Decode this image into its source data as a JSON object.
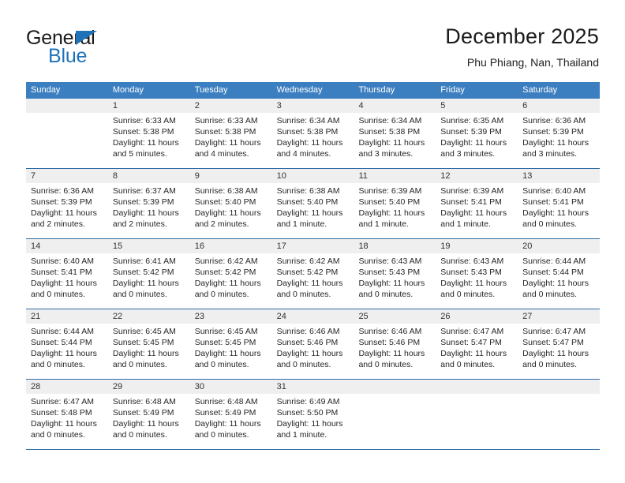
{
  "brand": {
    "name_dark": "General",
    "name_blue": "Blue",
    "triangle_icon": "triangle-logo-icon",
    "accent_color": "#1f72b8"
  },
  "header": {
    "month_title": "December 2025",
    "location": "Phu Phiang, Nan, Thailand"
  },
  "colors": {
    "header_blue": "#3c7fc0",
    "week_divider": "#2e6da4",
    "band_gray": "#efefef",
    "text": "#262626"
  },
  "weekdays": [
    "Sunday",
    "Monday",
    "Tuesday",
    "Wednesday",
    "Thursday",
    "Friday",
    "Saturday"
  ],
  "weeks": [
    {
      "days": [
        {
          "num": "",
          "sunrise": "",
          "sunset": "",
          "daylight_1": "",
          "daylight_2": "",
          "empty": true
        },
        {
          "num": "1",
          "sunrise": "Sunrise: 6:33 AM",
          "sunset": "Sunset: 5:38 PM",
          "daylight_1": "Daylight: 11 hours",
          "daylight_2": "and 5 minutes.",
          "empty": false
        },
        {
          "num": "2",
          "sunrise": "Sunrise: 6:33 AM",
          "sunset": "Sunset: 5:38 PM",
          "daylight_1": "Daylight: 11 hours",
          "daylight_2": "and 4 minutes.",
          "empty": false
        },
        {
          "num": "3",
          "sunrise": "Sunrise: 6:34 AM",
          "sunset": "Sunset: 5:38 PM",
          "daylight_1": "Daylight: 11 hours",
          "daylight_2": "and 4 minutes.",
          "empty": false
        },
        {
          "num": "4",
          "sunrise": "Sunrise: 6:34 AM",
          "sunset": "Sunset: 5:38 PM",
          "daylight_1": "Daylight: 11 hours",
          "daylight_2": "and 3 minutes.",
          "empty": false
        },
        {
          "num": "5",
          "sunrise": "Sunrise: 6:35 AM",
          "sunset": "Sunset: 5:39 PM",
          "daylight_1": "Daylight: 11 hours",
          "daylight_2": "and 3 minutes.",
          "empty": false
        },
        {
          "num": "6",
          "sunrise": "Sunrise: 6:36 AM",
          "sunset": "Sunset: 5:39 PM",
          "daylight_1": "Daylight: 11 hours",
          "daylight_2": "and 3 minutes.",
          "empty": false
        }
      ]
    },
    {
      "days": [
        {
          "num": "7",
          "sunrise": "Sunrise: 6:36 AM",
          "sunset": "Sunset: 5:39 PM",
          "daylight_1": "Daylight: 11 hours",
          "daylight_2": "and 2 minutes.",
          "empty": false
        },
        {
          "num": "8",
          "sunrise": "Sunrise: 6:37 AM",
          "sunset": "Sunset: 5:39 PM",
          "daylight_1": "Daylight: 11 hours",
          "daylight_2": "and 2 minutes.",
          "empty": false
        },
        {
          "num": "9",
          "sunrise": "Sunrise: 6:38 AM",
          "sunset": "Sunset: 5:40 PM",
          "daylight_1": "Daylight: 11 hours",
          "daylight_2": "and 2 minutes.",
          "empty": false
        },
        {
          "num": "10",
          "sunrise": "Sunrise: 6:38 AM",
          "sunset": "Sunset: 5:40 PM",
          "daylight_1": "Daylight: 11 hours",
          "daylight_2": "and 1 minute.",
          "empty": false
        },
        {
          "num": "11",
          "sunrise": "Sunrise: 6:39 AM",
          "sunset": "Sunset: 5:40 PM",
          "daylight_1": "Daylight: 11 hours",
          "daylight_2": "and 1 minute.",
          "empty": false
        },
        {
          "num": "12",
          "sunrise": "Sunrise: 6:39 AM",
          "sunset": "Sunset: 5:41 PM",
          "daylight_1": "Daylight: 11 hours",
          "daylight_2": "and 1 minute.",
          "empty": false
        },
        {
          "num": "13",
          "sunrise": "Sunrise: 6:40 AM",
          "sunset": "Sunset: 5:41 PM",
          "daylight_1": "Daylight: 11 hours",
          "daylight_2": "and 0 minutes.",
          "empty": false
        }
      ]
    },
    {
      "days": [
        {
          "num": "14",
          "sunrise": "Sunrise: 6:40 AM",
          "sunset": "Sunset: 5:41 PM",
          "daylight_1": "Daylight: 11 hours",
          "daylight_2": "and 0 minutes.",
          "empty": false
        },
        {
          "num": "15",
          "sunrise": "Sunrise: 6:41 AM",
          "sunset": "Sunset: 5:42 PM",
          "daylight_1": "Daylight: 11 hours",
          "daylight_2": "and 0 minutes.",
          "empty": false
        },
        {
          "num": "16",
          "sunrise": "Sunrise: 6:42 AM",
          "sunset": "Sunset: 5:42 PM",
          "daylight_1": "Daylight: 11 hours",
          "daylight_2": "and 0 minutes.",
          "empty": false
        },
        {
          "num": "17",
          "sunrise": "Sunrise: 6:42 AM",
          "sunset": "Sunset: 5:42 PM",
          "daylight_1": "Daylight: 11 hours",
          "daylight_2": "and 0 minutes.",
          "empty": false
        },
        {
          "num": "18",
          "sunrise": "Sunrise: 6:43 AM",
          "sunset": "Sunset: 5:43 PM",
          "daylight_1": "Daylight: 11 hours",
          "daylight_2": "and 0 minutes.",
          "empty": false
        },
        {
          "num": "19",
          "sunrise": "Sunrise: 6:43 AM",
          "sunset": "Sunset: 5:43 PM",
          "daylight_1": "Daylight: 11 hours",
          "daylight_2": "and 0 minutes.",
          "empty": false
        },
        {
          "num": "20",
          "sunrise": "Sunrise: 6:44 AM",
          "sunset": "Sunset: 5:44 PM",
          "daylight_1": "Daylight: 11 hours",
          "daylight_2": "and 0 minutes.",
          "empty": false
        }
      ]
    },
    {
      "days": [
        {
          "num": "21",
          "sunrise": "Sunrise: 6:44 AM",
          "sunset": "Sunset: 5:44 PM",
          "daylight_1": "Daylight: 11 hours",
          "daylight_2": "and 0 minutes.",
          "empty": false
        },
        {
          "num": "22",
          "sunrise": "Sunrise: 6:45 AM",
          "sunset": "Sunset: 5:45 PM",
          "daylight_1": "Daylight: 11 hours",
          "daylight_2": "and 0 minutes.",
          "empty": false
        },
        {
          "num": "23",
          "sunrise": "Sunrise: 6:45 AM",
          "sunset": "Sunset: 5:45 PM",
          "daylight_1": "Daylight: 11 hours",
          "daylight_2": "and 0 minutes.",
          "empty": false
        },
        {
          "num": "24",
          "sunrise": "Sunrise: 6:46 AM",
          "sunset": "Sunset: 5:46 PM",
          "daylight_1": "Daylight: 11 hours",
          "daylight_2": "and 0 minutes.",
          "empty": false
        },
        {
          "num": "25",
          "sunrise": "Sunrise: 6:46 AM",
          "sunset": "Sunset: 5:46 PM",
          "daylight_1": "Daylight: 11 hours",
          "daylight_2": "and 0 minutes.",
          "empty": false
        },
        {
          "num": "26",
          "sunrise": "Sunrise: 6:47 AM",
          "sunset": "Sunset: 5:47 PM",
          "daylight_1": "Daylight: 11 hours",
          "daylight_2": "and 0 minutes.",
          "empty": false
        },
        {
          "num": "27",
          "sunrise": "Sunrise: 6:47 AM",
          "sunset": "Sunset: 5:47 PM",
          "daylight_1": "Daylight: 11 hours",
          "daylight_2": "and 0 minutes.",
          "empty": false
        }
      ]
    },
    {
      "days": [
        {
          "num": "28",
          "sunrise": "Sunrise: 6:47 AM",
          "sunset": "Sunset: 5:48 PM",
          "daylight_1": "Daylight: 11 hours",
          "daylight_2": "and 0 minutes.",
          "empty": false
        },
        {
          "num": "29",
          "sunrise": "Sunrise: 6:48 AM",
          "sunset": "Sunset: 5:49 PM",
          "daylight_1": "Daylight: 11 hours",
          "daylight_2": "and 0 minutes.",
          "empty": false
        },
        {
          "num": "30",
          "sunrise": "Sunrise: 6:48 AM",
          "sunset": "Sunset: 5:49 PM",
          "daylight_1": "Daylight: 11 hours",
          "daylight_2": "and 0 minutes.",
          "empty": false
        },
        {
          "num": "31",
          "sunrise": "Sunrise: 6:49 AM",
          "sunset": "Sunset: 5:50 PM",
          "daylight_1": "Daylight: 11 hours",
          "daylight_2": "and 1 minute.",
          "empty": false
        },
        {
          "num": "",
          "sunrise": "",
          "sunset": "",
          "daylight_1": "",
          "daylight_2": "",
          "empty": true
        },
        {
          "num": "",
          "sunrise": "",
          "sunset": "",
          "daylight_1": "",
          "daylight_2": "",
          "empty": true
        },
        {
          "num": "",
          "sunrise": "",
          "sunset": "",
          "daylight_1": "",
          "daylight_2": "",
          "empty": true
        }
      ]
    }
  ]
}
